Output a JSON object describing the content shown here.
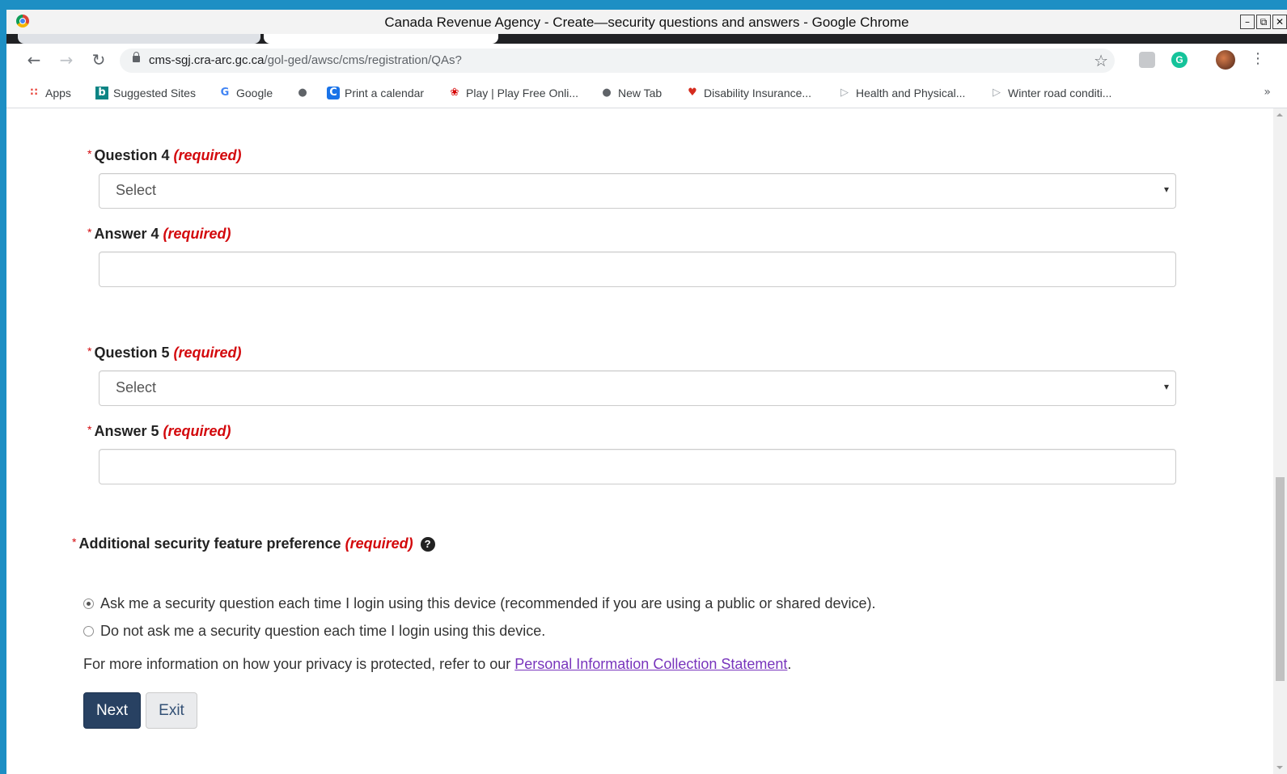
{
  "window": {
    "title": "Canada Revenue Agency - Create—security questions and answers - Google Chrome",
    "controls": {
      "minimize": "–",
      "restore": "⧉",
      "close": "✕"
    }
  },
  "toolbar": {
    "back": "←",
    "forward": "→",
    "reload": "↻",
    "url_host": "cms-sgj.cra-arc.gc.ca",
    "url_path": "/gol-ged/awsc/cms/registration/QAs?",
    "bookmark_star": "☆",
    "ext_grammarly": "G",
    "menu": "⋮"
  },
  "bookmarks": {
    "items": [
      {
        "label": "Apps",
        "icon": "apps-grid-icon",
        "glyph": "∷",
        "color": "#e8453c"
      },
      {
        "label": "Suggested Sites",
        "icon": "bing-icon",
        "glyph": "b",
        "color": "#0c8484"
      },
      {
        "label": "Google",
        "icon": "google-icon",
        "glyph": "G",
        "color": "#4285f4"
      },
      {
        "label": "",
        "icon": "globe-icon",
        "glyph": "●",
        "color": "#5f6368"
      },
      {
        "label": "Print a calendar",
        "icon": "calendar-site-icon",
        "glyph": "C",
        "color": "#1a73e8"
      },
      {
        "label": "Play | Play Free Onli...",
        "icon": "cbc-icon",
        "glyph": "❀",
        "color": "#d50000"
      },
      {
        "label": "New Tab",
        "icon": "globe-icon",
        "glyph": "●",
        "color": "#5f6368"
      },
      {
        "label": "Disability Insurance...",
        "icon": "maple-leaf-icon",
        "glyph": "♥",
        "color": "#d52b1e"
      },
      {
        "label": "Health and Physical...",
        "icon": "page-icon",
        "glyph": "▷",
        "color": "#9aa0a6"
      },
      {
        "label": "Winter road conditi...",
        "icon": "page-icon",
        "glyph": "▷",
        "color": "#9aa0a6"
      }
    ],
    "more": "»"
  },
  "form": {
    "asterisk": "*",
    "required_text": "(required)",
    "question4": {
      "label": "Question 4",
      "value": "Select"
    },
    "answer4": {
      "label": "Answer 4",
      "value": ""
    },
    "question5": {
      "label": "Question 5",
      "value": "Select"
    },
    "answer5": {
      "label": "Answer 5",
      "value": ""
    },
    "select_caret": "▾",
    "preference": {
      "label": "Additional security feature preference",
      "help": "?",
      "options": [
        {
          "label": "Ask me a security question each time I login using this device (recommended if you are using a public or shared device).",
          "checked": true
        },
        {
          "label": "Do not ask me a security question each time I login using this device.",
          "checked": false
        }
      ]
    },
    "info_prefix": "For more information on how your privacy is protected, refer to our ",
    "info_link": "Personal Information Collection Statement",
    "info_suffix": ".",
    "next_label": "Next",
    "exit_label": "Exit"
  }
}
